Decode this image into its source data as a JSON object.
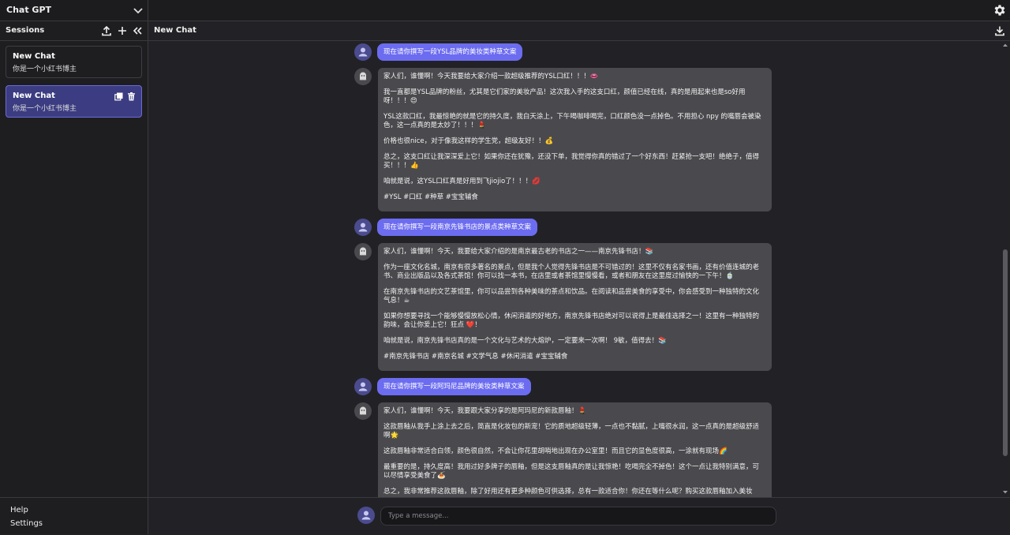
{
  "app": {
    "title": "Chat GPT"
  },
  "sidebar": {
    "title": "Sessions",
    "chats": [
      {
        "title": "New Chat",
        "subtitle": "你是一个小红书博主",
        "active": false
      },
      {
        "title": "New Chat",
        "subtitle": "你是一个小红书博主",
        "active": true
      }
    ],
    "footer": {
      "help": "Help",
      "settings": "Settings"
    }
  },
  "main": {
    "title": "New Chat"
  },
  "messages": [
    {
      "role": "user",
      "text": "现在请你撰写一段YSL品牌的美妆类种草文案"
    },
    {
      "role": "bot",
      "paragraphs": [
        "家人们，谁懂啊！今天我要给大家介绍一款超级推荐的YSL口红！！！👄",
        "我一直都是YSL品牌的粉丝，尤其是它们家的美妆产品！这次我入手的这支口红，颜值已经在线，真的是用起来也是so好用呀！！！😍",
        "YSL这款口红，我最惊艳的就是它的持久度，我白天涂上，下午喝咖啡喝完，口红颜色没一点掉色。不用担心 npy 的嘴唇会被染色，这一点真的是太妙了！！！💄",
        "价格也很nice，对于像我这样的学生党，超级友好！！💰",
        "总之，这支口红让我深深爱上它！如果你还在犹豫，还没下单，我觉得你真的错过了一个好东西！赶紧抢一支吧！绝绝子，值得买！！！👍",
        "咱就是说，这YSL口红真是好用到飞jiojio了！！！💋",
        "#YSL #口红 #种草 #宝宝辅食"
      ]
    },
    {
      "role": "user",
      "text": "现在请你撰写一段南京先锋书店的景点类种草文案"
    },
    {
      "role": "bot",
      "paragraphs": [
        "家人们，谁懂啊！今天，我要给大家介绍的是南京最古老的书店之一——南京先锋书店！📚",
        "作为一座文化名城，南京有很多著名的景点，但是我个人觉得先锋书店是不可错过的！这里不仅有名家书画，还有价值连城的老书、商业出版品以及各式茶馆！你可以找一本书，在店里或者茶馆里慢慢看，或者和朋友在这里度过愉快的一下午！🍵",
        "在南京先锋书店的文艺茶馆里，你可以品尝到各种美味的茶点和饮品。在阅读和品尝美食的享受中，你会感受到一种独特的文化气息！☕",
        "如果你想要寻找一个能够慢慢放松心情，休闲消遣的好地方，南京先锋书店绝对可以说得上是最佳选择之一！这里有一种独特的韵味，会让你爱上它！狂点 ❤️！",
        "咱就是说，南京先锋书店真的是一个文化与艺术的大熔炉，一定要来一次啊！ 9敏，值得去！📚",
        "#南京先锋书店 #南京名城 #文学气息 #休闲消遣 #宝宝辅食"
      ]
    },
    {
      "role": "user",
      "text": "现在请你撰写一段阿玛尼品牌的美妆类种草文案"
    },
    {
      "role": "bot",
      "paragraphs": [
        "家人们，谁懂啊！今天，我要跟大家分享的是阿玛尼的新款唇釉！💄",
        "这款唇釉从我手上涂上去之后，简直是化妆包的新宠！它的质地超级轻薄，一点也不黏腻，上嘴很水润，这一点真的是超级舒适啊🌟",
        "这款唇釉非常适合白领，颜色很自然，不会让你花里胡哨地出现在办公室里！而且它的显色度很高，一涂就有现场🌈",
        "最重要的是，持久度高！我用过好多牌子的唇釉，但是这支唇釉真的是让我惊艳！吃喝完全不掉色！这个一点让我特别满意，可以尽情享受美食了🍝",
        "总之，我非常推荐这款唇釉，除了好用还有更多种颜色可供选择，总有一款适合你！你还在等什么呢？购买这款唇釉加入美妆"
      ]
    }
  ],
  "composer": {
    "placeholder": "Type a message..."
  },
  "icons": {
    "collapse": "chevron-down-icon",
    "settings": "gear-icon",
    "upload": "upload-icon",
    "add": "plus-icon",
    "collapse_sidebar": "double-chevron-left-icon",
    "download": "download-icon",
    "copy": "copy-icon",
    "delete": "trash-icon",
    "user": "user-icon",
    "bot": "ghost-icon"
  },
  "colors": {
    "accent": "#6c6cf0",
    "active_item": "#3c3c82",
    "bot_bubble": "#4a4a4e",
    "background": "#222226"
  }
}
